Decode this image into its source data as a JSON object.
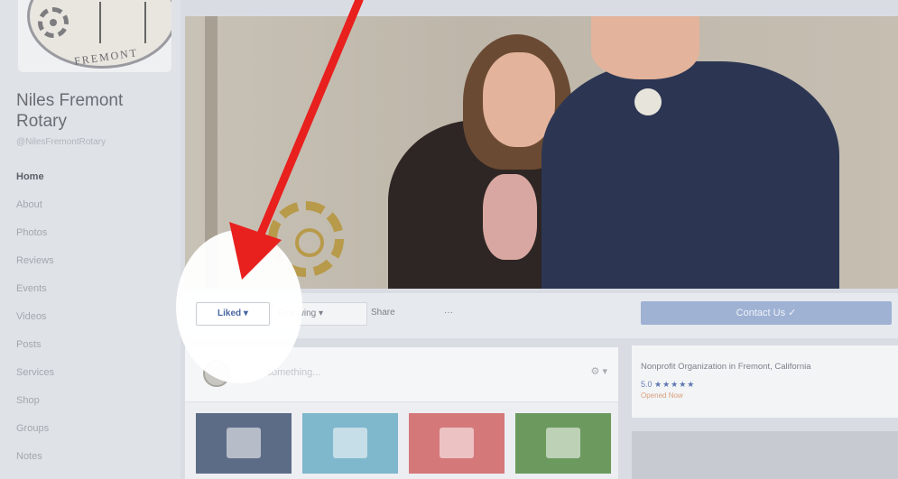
{
  "sidebar": {
    "page_name": "Niles Fremont Rotary",
    "page_handle": "@NilesFremontRotary",
    "logo_text": "FREMONT",
    "items": [
      {
        "label": "Home"
      },
      {
        "label": "About"
      },
      {
        "label": "Photos"
      },
      {
        "label": "Reviews"
      },
      {
        "label": "Events"
      },
      {
        "label": "Videos"
      },
      {
        "label": "Posts"
      },
      {
        "label": "Services"
      },
      {
        "label": "Shop"
      },
      {
        "label": "Groups"
      },
      {
        "label": "Notes"
      }
    ]
  },
  "actions": {
    "liked": "Liked ▾",
    "following": "Following ▾",
    "share": "Share",
    "more": "···",
    "contact": "Contact Us ✓"
  },
  "composer": {
    "prompt": "Write something...",
    "settings": "⚙ ▾"
  },
  "info": {
    "category": "Nonprofit Organization in Fremont, California",
    "rating": "5.0",
    "stars": "★★★★★",
    "rating_link": "Opened Now"
  },
  "colors": {
    "arrow": "#e8201e",
    "accent": "#4b67a1",
    "contact_button": "#9fb2d4"
  }
}
